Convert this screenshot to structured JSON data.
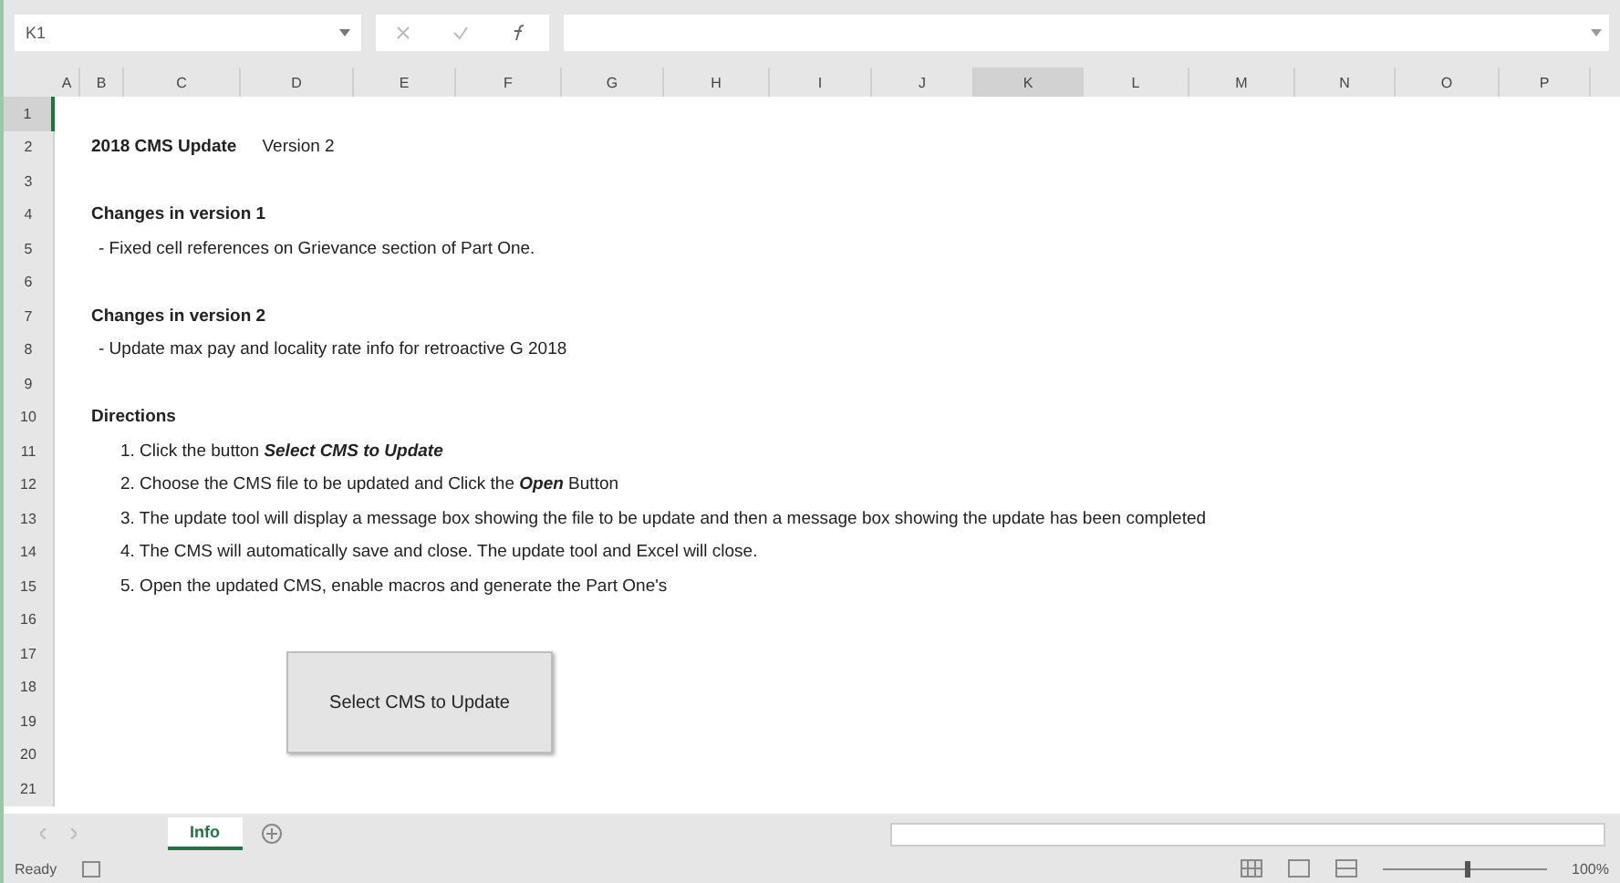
{
  "name_box": "K1",
  "columns": [
    {
      "label": "A",
      "selected": false
    },
    {
      "label": "B",
      "selected": false
    },
    {
      "label": "C",
      "selected": false
    },
    {
      "label": "D",
      "selected": false
    },
    {
      "label": "E",
      "selected": false
    },
    {
      "label": "F",
      "selected": false
    },
    {
      "label": "G",
      "selected": false
    },
    {
      "label": "H",
      "selected": false
    },
    {
      "label": "I",
      "selected": false
    },
    {
      "label": "J",
      "selected": false
    },
    {
      "label": "K",
      "selected": true
    },
    {
      "label": "L",
      "selected": false
    },
    {
      "label": "M",
      "selected": false
    },
    {
      "label": "N",
      "selected": false
    },
    {
      "label": "O",
      "selected": false
    },
    {
      "label": "P",
      "selected": false
    }
  ],
  "rows": [
    {
      "number": "1",
      "selected": true,
      "kind": "blank"
    },
    {
      "number": "2",
      "selected": false,
      "kind": "title",
      "text": "2018 CMS Update",
      "note": "Version 2"
    },
    {
      "number": "3",
      "selected": false,
      "kind": "blank"
    },
    {
      "number": "4",
      "selected": false,
      "kind": "heading",
      "text": "Changes in version 1"
    },
    {
      "number": "5",
      "selected": false,
      "kind": "bullet",
      "text": "- Fixed cell references on Grievance section of Part One."
    },
    {
      "number": "6",
      "selected": false,
      "kind": "blank"
    },
    {
      "number": "7",
      "selected": false,
      "kind": "heading",
      "text": "Changes in version 2"
    },
    {
      "number": "8",
      "selected": false,
      "kind": "bullet",
      "text": "- Update max pay and locality rate info for retroactive G 2018"
    },
    {
      "number": "9",
      "selected": false,
      "kind": "blank"
    },
    {
      "number": "10",
      "selected": false,
      "kind": "heading",
      "text": "Directions"
    },
    {
      "number": "11",
      "selected": false,
      "kind": "step",
      "text": "1. Click the button **Select CMS to Update**"
    },
    {
      "number": "12",
      "selected": false,
      "kind": "step",
      "text": "2. Choose the CMS file to be updated and Click the **Open** Button"
    },
    {
      "number": "13",
      "selected": false,
      "kind": "step",
      "text": "3. The update tool will display a message box showing the file to be update and then a message box showing the update has been completed"
    },
    {
      "number": "14",
      "selected": false,
      "kind": "step",
      "text": "4. The CMS will automatically save and close. The update tool and Excel will close."
    },
    {
      "number": "15",
      "selected": false,
      "kind": "step",
      "text": "5. Open the updated CMS, enable macros and generate the Part One's"
    },
    {
      "number": "16",
      "selected": false,
      "kind": "blank"
    },
    {
      "number": "17",
      "selected": false,
      "kind": "blank"
    },
    {
      "number": "18",
      "selected": false,
      "kind": "blank"
    },
    {
      "number": "19",
      "selected": false,
      "kind": "blank"
    },
    {
      "number": "20",
      "selected": false,
      "kind": "blank"
    },
    {
      "number": "21",
      "selected": false,
      "kind": "blank"
    }
  ],
  "macro_button": "Select CMS to Update",
  "sheet_tabs": [
    {
      "label": "Info",
      "selected": true
    }
  ],
  "status_bar": {
    "status": "Ready",
    "zoom": "100%",
    "level": 0.5
  }
}
